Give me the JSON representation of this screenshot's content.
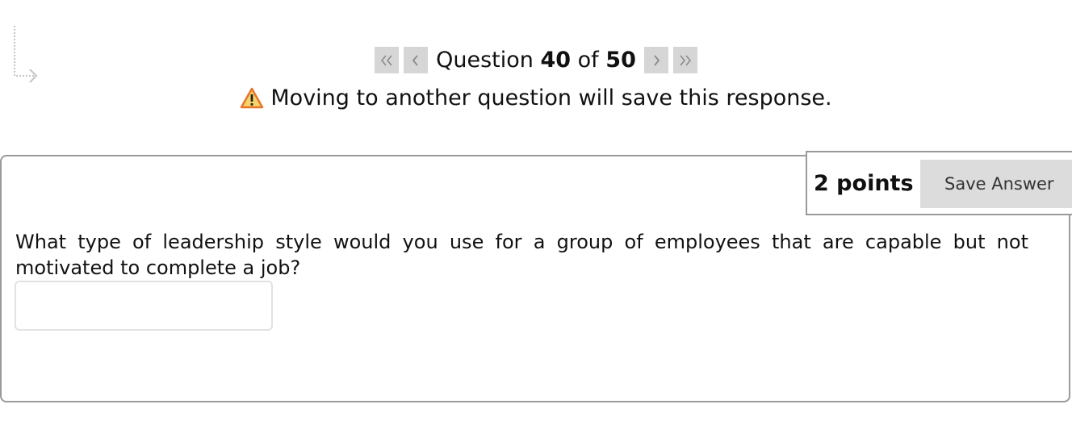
{
  "navigation": {
    "question_label": "Question",
    "current_question": "40",
    "of_label": "of",
    "total_questions": "50",
    "icons": {
      "first": "double-chevron-left-icon",
      "previous": "chevron-left-icon",
      "next": "chevron-right-icon",
      "last": "double-chevron-right-icon"
    }
  },
  "warning": {
    "icon": "warning-triangle-icon",
    "text": "Moving to another question will save this response."
  },
  "question": {
    "points": "2 points",
    "save_label": "Save Answer",
    "prompt": "What type of leadership style would you use for a group of employees that are capable but not motivated to complete a job?",
    "answer_value": "",
    "answer_placeholder": ""
  },
  "colors": {
    "nav_button_bg": "#d6d6d6",
    "warning_orange": "#e8742a",
    "card_border": "#9a9a9a",
    "save_button_bg": "#dcdcdc"
  },
  "decor": {
    "corner_icon": "corner-down-right-arrow-icon"
  }
}
